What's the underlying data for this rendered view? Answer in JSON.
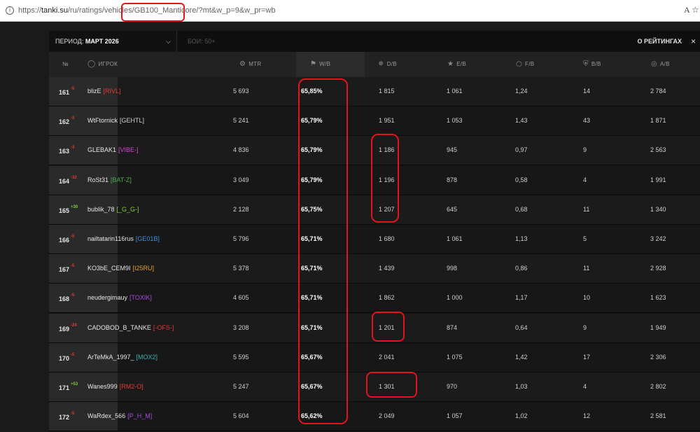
{
  "browser": {
    "info_icon": "i",
    "url_prefix": "https://",
    "url_host": "tanki.su",
    "url_path": "/ru/ratings/vehicles/",
    "url_vehicle": "GB100_Manticore",
    "url_query": "/?mt&w_p=9&w_pr=wb",
    "read_aloud_icon": "A",
    "favorite_icon": "☆"
  },
  "filters": {
    "period_label": "ПЕРИОД:",
    "period_value": "МАРТ 2026",
    "battles": "БОИ: 50+",
    "about": "О РЕЙТИНГАХ",
    "close_icon": "×"
  },
  "columns": {
    "rank": "№",
    "player": "ИГРОК",
    "mtr": "MTR",
    "wb": "W/B",
    "db": "D/B",
    "eb": "E/B",
    "fb": "F/B",
    "bb": "B/B",
    "ab": "A/B"
  },
  "rows": [
    {
      "rank": "161",
      "delta": "-5",
      "delta_color": "#e53935",
      "name": "blizE",
      "clan": "[RIVL]",
      "clan_color": "#e53935",
      "mtr": "5 693",
      "wb": "65,85%",
      "db": "1 815",
      "eb": "1 061",
      "fb": "1,24",
      "bb": "14",
      "ab": "2 784"
    },
    {
      "rank": "162",
      "delta": "-3",
      "delta_color": "#e53935",
      "name": "WtFtornick",
      "clan": "[GEHTL]",
      "clan_color": "#d0d0d0",
      "mtr": "5 241",
      "wb": "65,79%",
      "db": "1 951",
      "eb": "1 053",
      "fb": "1,43",
      "bb": "43",
      "ab": "1 871"
    },
    {
      "rank": "163",
      "delta": "-3",
      "delta_color": "#e53935",
      "name": "GLEBAK1",
      "clan": "[VIBE-]",
      "clan_color": "#d04ad0",
      "mtr": "4 836",
      "wb": "65,79%",
      "db": "1 186",
      "eb": "945",
      "fb": "0,97",
      "bb": "9",
      "ab": "2 563"
    },
    {
      "rank": "164",
      "delta": "-32",
      "delta_color": "#e53935",
      "name": "RoSt31",
      "clan": "[BAT-Z]",
      "clan_color": "#4caf50",
      "mtr": "3 049",
      "wb": "65,79%",
      "db": "1 196",
      "eb": "878",
      "fb": "0,58",
      "bb": "4",
      "ab": "1 991"
    },
    {
      "rank": "165",
      "delta": "+30",
      "delta_color": "#7cd33a",
      "name": "bublik_78",
      "clan": "[_G_G-]",
      "clan_color": "#7cd33a",
      "mtr": "2 128",
      "wb": "65,75%",
      "db": "1 207",
      "eb": "645",
      "fb": "0,68",
      "bb": "11",
      "ab": "1 340"
    },
    {
      "rank": "166",
      "delta": "-5",
      "delta_color": "#e53935",
      "name": "nailtatarin116rus",
      "clan": "[GE01B]",
      "clan_color": "#3b8fe0",
      "mtr": "5 796",
      "wb": "65,71%",
      "db": "1 680",
      "eb": "1 061",
      "fb": "1,13",
      "bb": "5",
      "ab": "3 242"
    },
    {
      "rank": "167",
      "delta": "-5",
      "delta_color": "#e53935",
      "name": "KO3bE_CEM9I",
      "clan": "[I25RU]",
      "clan_color": "#e0a030",
      "mtr": "5 378",
      "wb": "65,71%",
      "db": "1 439",
      "eb": "998",
      "fb": "0,86",
      "bb": "11",
      "ab": "2 928"
    },
    {
      "rank": "168",
      "delta": "-5",
      "delta_color": "#e53935",
      "name": "neudergimauy",
      "clan": "[TOXIK]",
      "clan_color": "#a64ae0",
      "mtr": "4 605",
      "wb": "65,71%",
      "db": "1 862",
      "eb": "1 000",
      "fb": "1,17",
      "bb": "10",
      "ab": "1 623"
    },
    {
      "rank": "169",
      "delta": "-24",
      "delta_color": "#e53935",
      "name": "CADOBOD_B_TANKE",
      "clan": "[-OFS-]",
      "clan_color": "#e53935",
      "mtr": "3 208",
      "wb": "65,71%",
      "db": "1 201",
      "eb": "874",
      "fb": "0,64",
      "bb": "9",
      "ab": "1 949"
    },
    {
      "rank": "170",
      "delta": "-5",
      "delta_color": "#e53935",
      "name": "ArTeMkA_1997_",
      "clan": "[MOX2]",
      "clan_color": "#3bb0b0",
      "mtr": "5 595",
      "wb": "65,67%",
      "db": "2 041",
      "eb": "1 075",
      "fb": "1,42",
      "bb": "17",
      "ab": "2 306"
    },
    {
      "rank": "171",
      "delta": "+53",
      "delta_color": "#7cd33a",
      "name": "Wanes999",
      "clan": "[RM2-O]",
      "clan_color": "#e53935",
      "mtr": "5 247",
      "wb": "65,67%",
      "db": "1 301",
      "eb": "970",
      "fb": "1,03",
      "bb": "4",
      "ab": "2 802"
    },
    {
      "rank": "172",
      "delta": "-5",
      "delta_color": "#e53935",
      "name": "WaRdex_566",
      "clan": "[P_H_M]",
      "clan_color": "#a64ae0",
      "mtr": "5 604",
      "wb": "65,62%",
      "db": "2 049",
      "eb": "1 057",
      "fb": "1,02",
      "bb": "12",
      "ab": "2 581"
    }
  ],
  "colors": {
    "annotation": "#e2141c",
    "positive": "#7cd33a",
    "negative": "#e53935"
  },
  "icons": {
    "player": "user-circle-icon",
    "mtr": "mtr-gear-icon",
    "wb": "flag-icon",
    "db": "damage-icon",
    "eb": "star-icon",
    "fb": "spot-icon",
    "bb": "shield-icon",
    "ab": "assist-icon"
  }
}
